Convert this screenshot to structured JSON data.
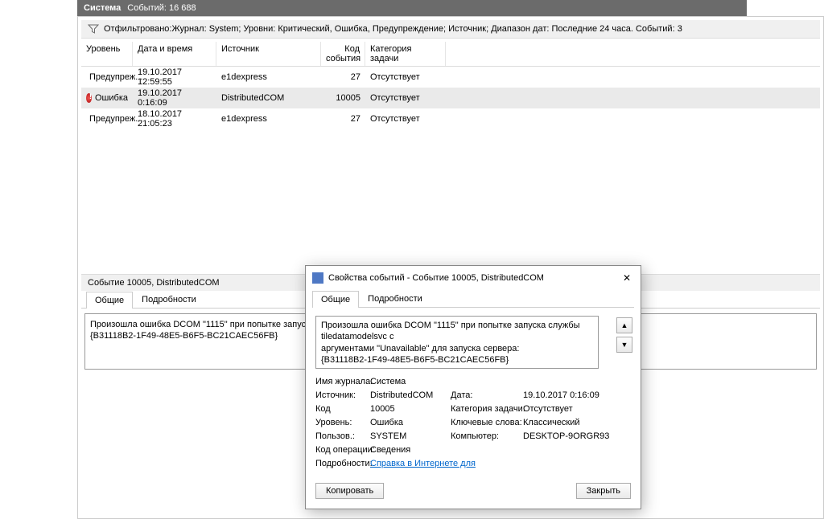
{
  "titlebar": {
    "app": "Система",
    "events_label": "Событий:",
    "events_count": "16 688"
  },
  "filter": {
    "text": "Отфильтровано:Журнал: System; Уровни: Критический, Ошибка, Предупреждение; Источник; Диапазон дат: Последние 24 часа. Событий: 3"
  },
  "columns": {
    "level": "Уровень",
    "date": "Дата и время",
    "source": "Источник",
    "id": "Код события",
    "category": "Категория задачи"
  },
  "events": [
    {
      "level_icon": "warn",
      "level": "Предупреж...",
      "date": "19.10.2017 12:59:55",
      "source": "e1dexpress",
      "id": "27",
      "category": "Отсутствует"
    },
    {
      "level_icon": "error",
      "level": "Ошибка",
      "date": "19.10.2017 0:16:09",
      "source": "DistributedCOM",
      "id": "10005",
      "category": "Отсутствует",
      "selected": true
    },
    {
      "level_icon": "warn",
      "level": "Предупреж...",
      "date": "18.10.2017 21:05:23",
      "source": "e1dexpress",
      "id": "27",
      "category": "Отсутствует"
    }
  ],
  "detail": {
    "header": "Событие 10005, DistributedCOM",
    "tabs": {
      "general": "Общие",
      "details": "Подробности"
    },
    "message_l1": "Произошла ошибка DCOM \"1115\" при попытке запуска службы tiledatamodelsvc с аргументами \"Unavailable\" для запуска сервера:",
    "message_l2": "{B31118B2-1F49-48E5-B6F5-BC21CAEC56FB}"
  },
  "dialog": {
    "title": "Свойства событий - Событие 10005, DistributedCOM",
    "tabs": {
      "general": "Общие",
      "details": "Подробности"
    },
    "message_l1": "Произошла ошибка DCOM \"1115\" при попытке запуска службы tiledatamodelsvc с",
    "message_l2": "аргументами \"Unavailable\" для запуска сервера:",
    "message_l3": "{B31118B2-1F49-48E5-B6F5-BC21CAEC56FB}",
    "fields": {
      "log_lbl": "Имя журнала:",
      "log_val": "Система",
      "src_lbl": "Источник:",
      "src_val": "DistributedCOM",
      "date_lbl": "Дата:",
      "date_val": "19.10.2017 0:16:09",
      "id_lbl": "Код",
      "id_val": "10005",
      "cat_lbl": "Категория задачи:",
      "cat_val": "Отсутствует",
      "lvl_lbl": "Уровень:",
      "lvl_val": "Ошибка",
      "kw_lbl": "Ключевые слова:",
      "kw_val": "Классический",
      "usr_lbl": "Пользов.:",
      "usr_val": "SYSTEM",
      "comp_lbl": "Компьютер:",
      "comp_val": "DESKTOP-9ORGR93",
      "op_lbl": "Код операции:",
      "op_val": "Сведения",
      "help_lbl": "Подробности:",
      "help_link": "Справка в Интернете для "
    },
    "buttons": {
      "copy": "Копировать",
      "close": "Закрыть"
    },
    "nav": {
      "up": "▲",
      "down": "▼"
    }
  }
}
